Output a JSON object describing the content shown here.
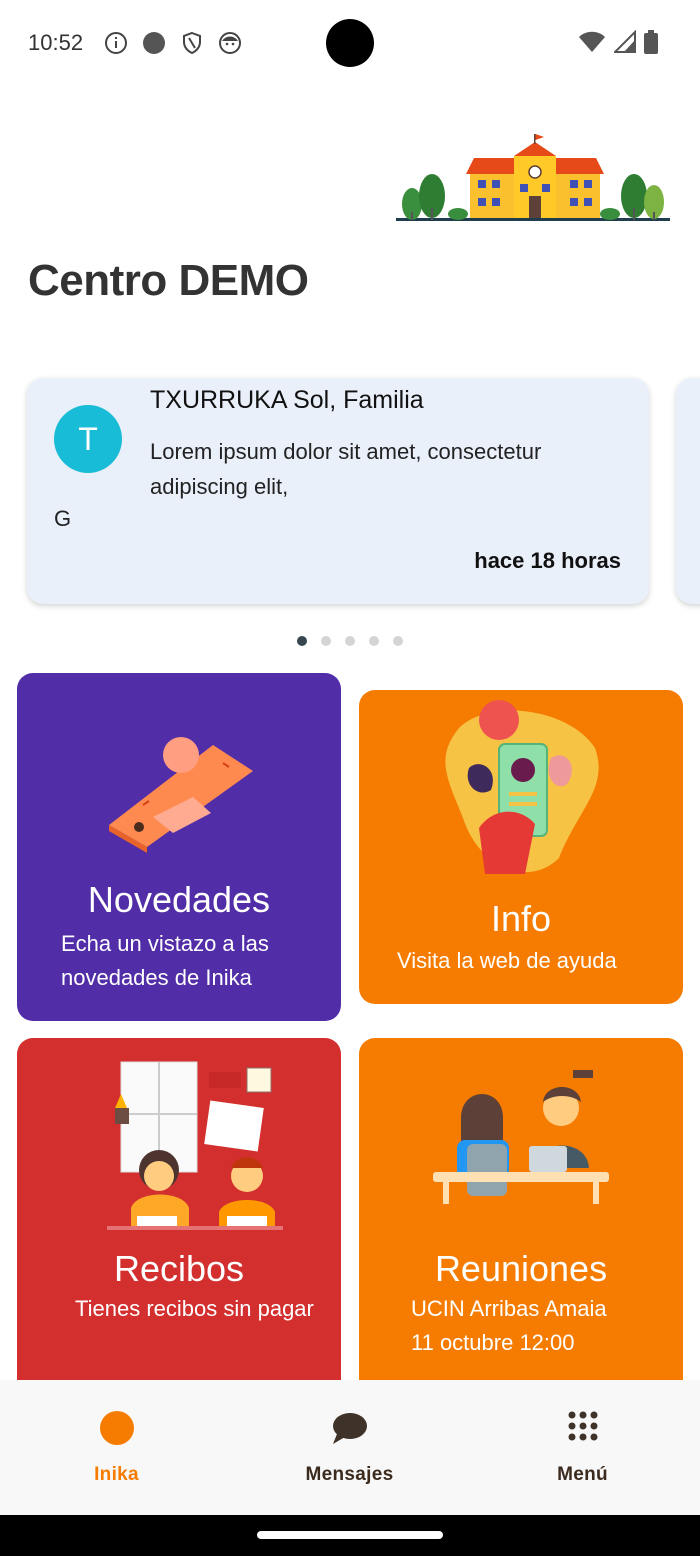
{
  "status_bar": {
    "time": "10:52",
    "icons": [
      "info-icon",
      "circle-icon",
      "shield-icon",
      "face-icon",
      "wifi-icon",
      "signal-icon",
      "battery-icon"
    ]
  },
  "header": {
    "title": "Centro DEMO"
  },
  "message_card": {
    "avatar_letter": "T",
    "avatar_color": "#19bcd6",
    "sender": "TXURRUKA Sol, Familia",
    "body": "Lorem ipsum dolor sit amet, consectetur adipiscing elit,",
    "extra": "G",
    "time": "hace 18 horas"
  },
  "pager": {
    "count": 5,
    "active": 0
  },
  "tiles": {
    "novedades": {
      "title": "Novedades",
      "subtitle": "Echa un vistazo a las novedades de Inika",
      "color": "#512da8"
    },
    "info": {
      "title": "Info",
      "subtitle": "Visita la web de ayuda",
      "color": "#f57c00"
    },
    "recibos": {
      "title": "Recibos",
      "subtitle": "Tienes recibos sin pagar",
      "color": "#d32f2f"
    },
    "reuniones": {
      "title": "Reuniones",
      "subtitle_line1": "UCIN Arribas Amaia",
      "subtitle_line2": "11 octubre 12:00",
      "color": "#f57c00"
    }
  },
  "bottom_nav": {
    "items": [
      {
        "label": "Inika",
        "icon": "circle-icon",
        "active": true
      },
      {
        "label": "Mensajes",
        "icon": "chat-bubble-icon",
        "active": false
      },
      {
        "label": "Menú",
        "icon": "grid-icon",
        "active": false
      }
    ],
    "accent": "#f57c00"
  }
}
